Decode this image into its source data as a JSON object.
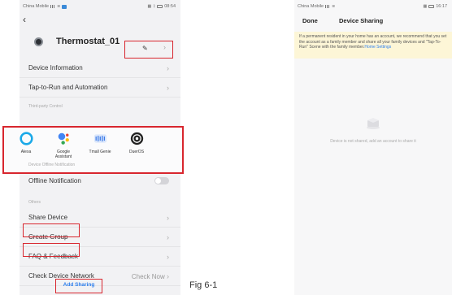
{
  "left": {
    "status": {
      "carrier": "China Mobile",
      "time": "08:54"
    },
    "device_name": "Thermostat_01",
    "menu": {
      "device_info": "Device Information",
      "tap_to_run": "Tap-to-Run and Automation"
    },
    "third_party": {
      "section_label": "Third-party Control",
      "items": [
        {
          "label": "Alexa",
          "icon": "alexa-icon"
        },
        {
          "label": "Google\nAssistant",
          "icon": "google-assistant-icon"
        },
        {
          "label": "Tmall Genie",
          "icon": "tmall-genie-icon"
        },
        {
          "label": "DuerOS",
          "icon": "dueros-icon"
        }
      ]
    },
    "offline": {
      "section_label": "Device Offline Notification",
      "label": "Offline Notification",
      "enabled": false
    },
    "others": {
      "section_label": "Others",
      "share_device": "Share Device",
      "create_group": "Create Group",
      "faq": "FAQ & Feedback",
      "check_network": "Check Device Network",
      "check_now": "Check Now"
    }
  },
  "caption": "Fig 6-1",
  "right": {
    "status": {
      "carrier": "China Mobile",
      "time": "16:17"
    },
    "done": "Done",
    "title": "Device Sharing",
    "notice_text": "If a permanent resident in your home has an account, we recommend that you set the account as a family member and share all your family devices and \"Tap-To-Run\" Scene with the family member.",
    "notice_link": "Home Settings",
    "empty_text": "Device is not shared, add an account to share it",
    "add_sharing": "Add Sharing"
  },
  "colors": {
    "highlight": "#d8262e",
    "link": "#2f80ed",
    "notice_bg": "#fdf6d7"
  }
}
